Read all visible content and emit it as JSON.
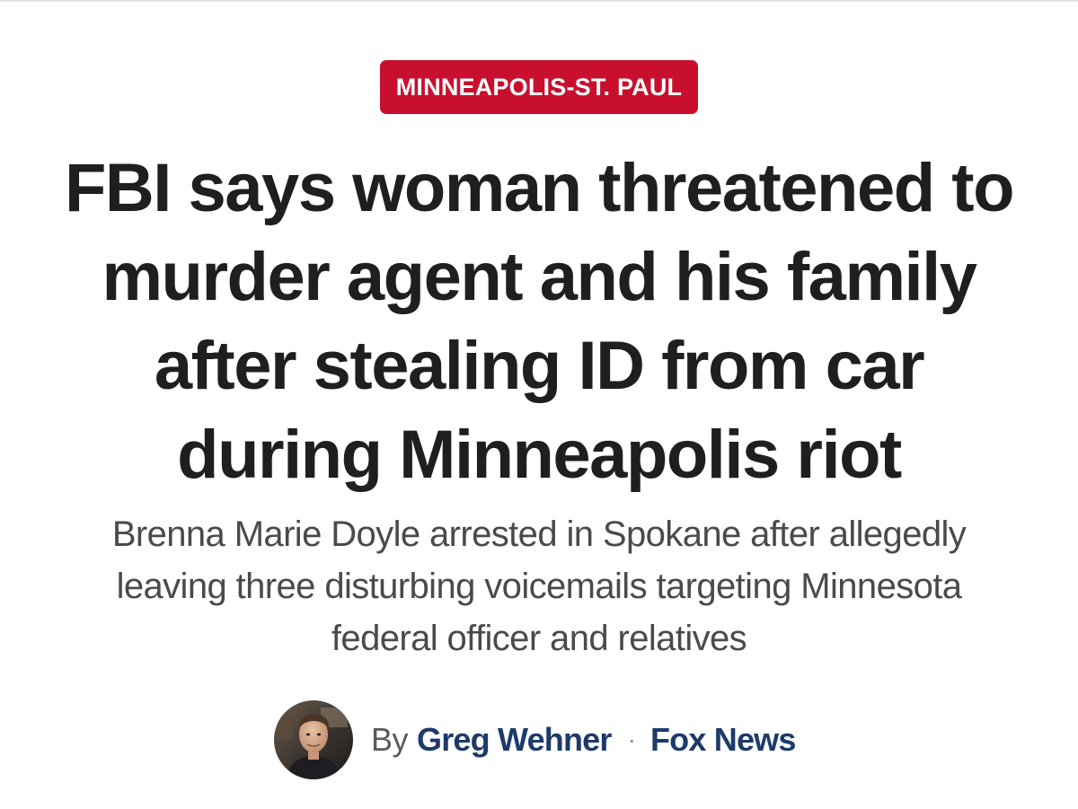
{
  "article": {
    "category": "MINNEAPOLIS-ST. PAUL",
    "headline": "FBI says woman threatened to murder agent and his family after stealing ID from car during Minneapolis riot",
    "subheadline": "Brenna Marie Doyle arrested in Spokane after allegedly leaving three disturbing voicemails targeting Minnesota federal officer and relatives"
  },
  "byline": {
    "prefix": "By",
    "author": "Greg Wehner",
    "separator": "·",
    "source": "Fox News",
    "avatar_icon": "author-photo"
  },
  "colors": {
    "badge_bg": "#c8102e",
    "headline_text": "#1f1f1f",
    "subhead_text": "#4a4a4a",
    "author_link": "#1d3a6b"
  }
}
